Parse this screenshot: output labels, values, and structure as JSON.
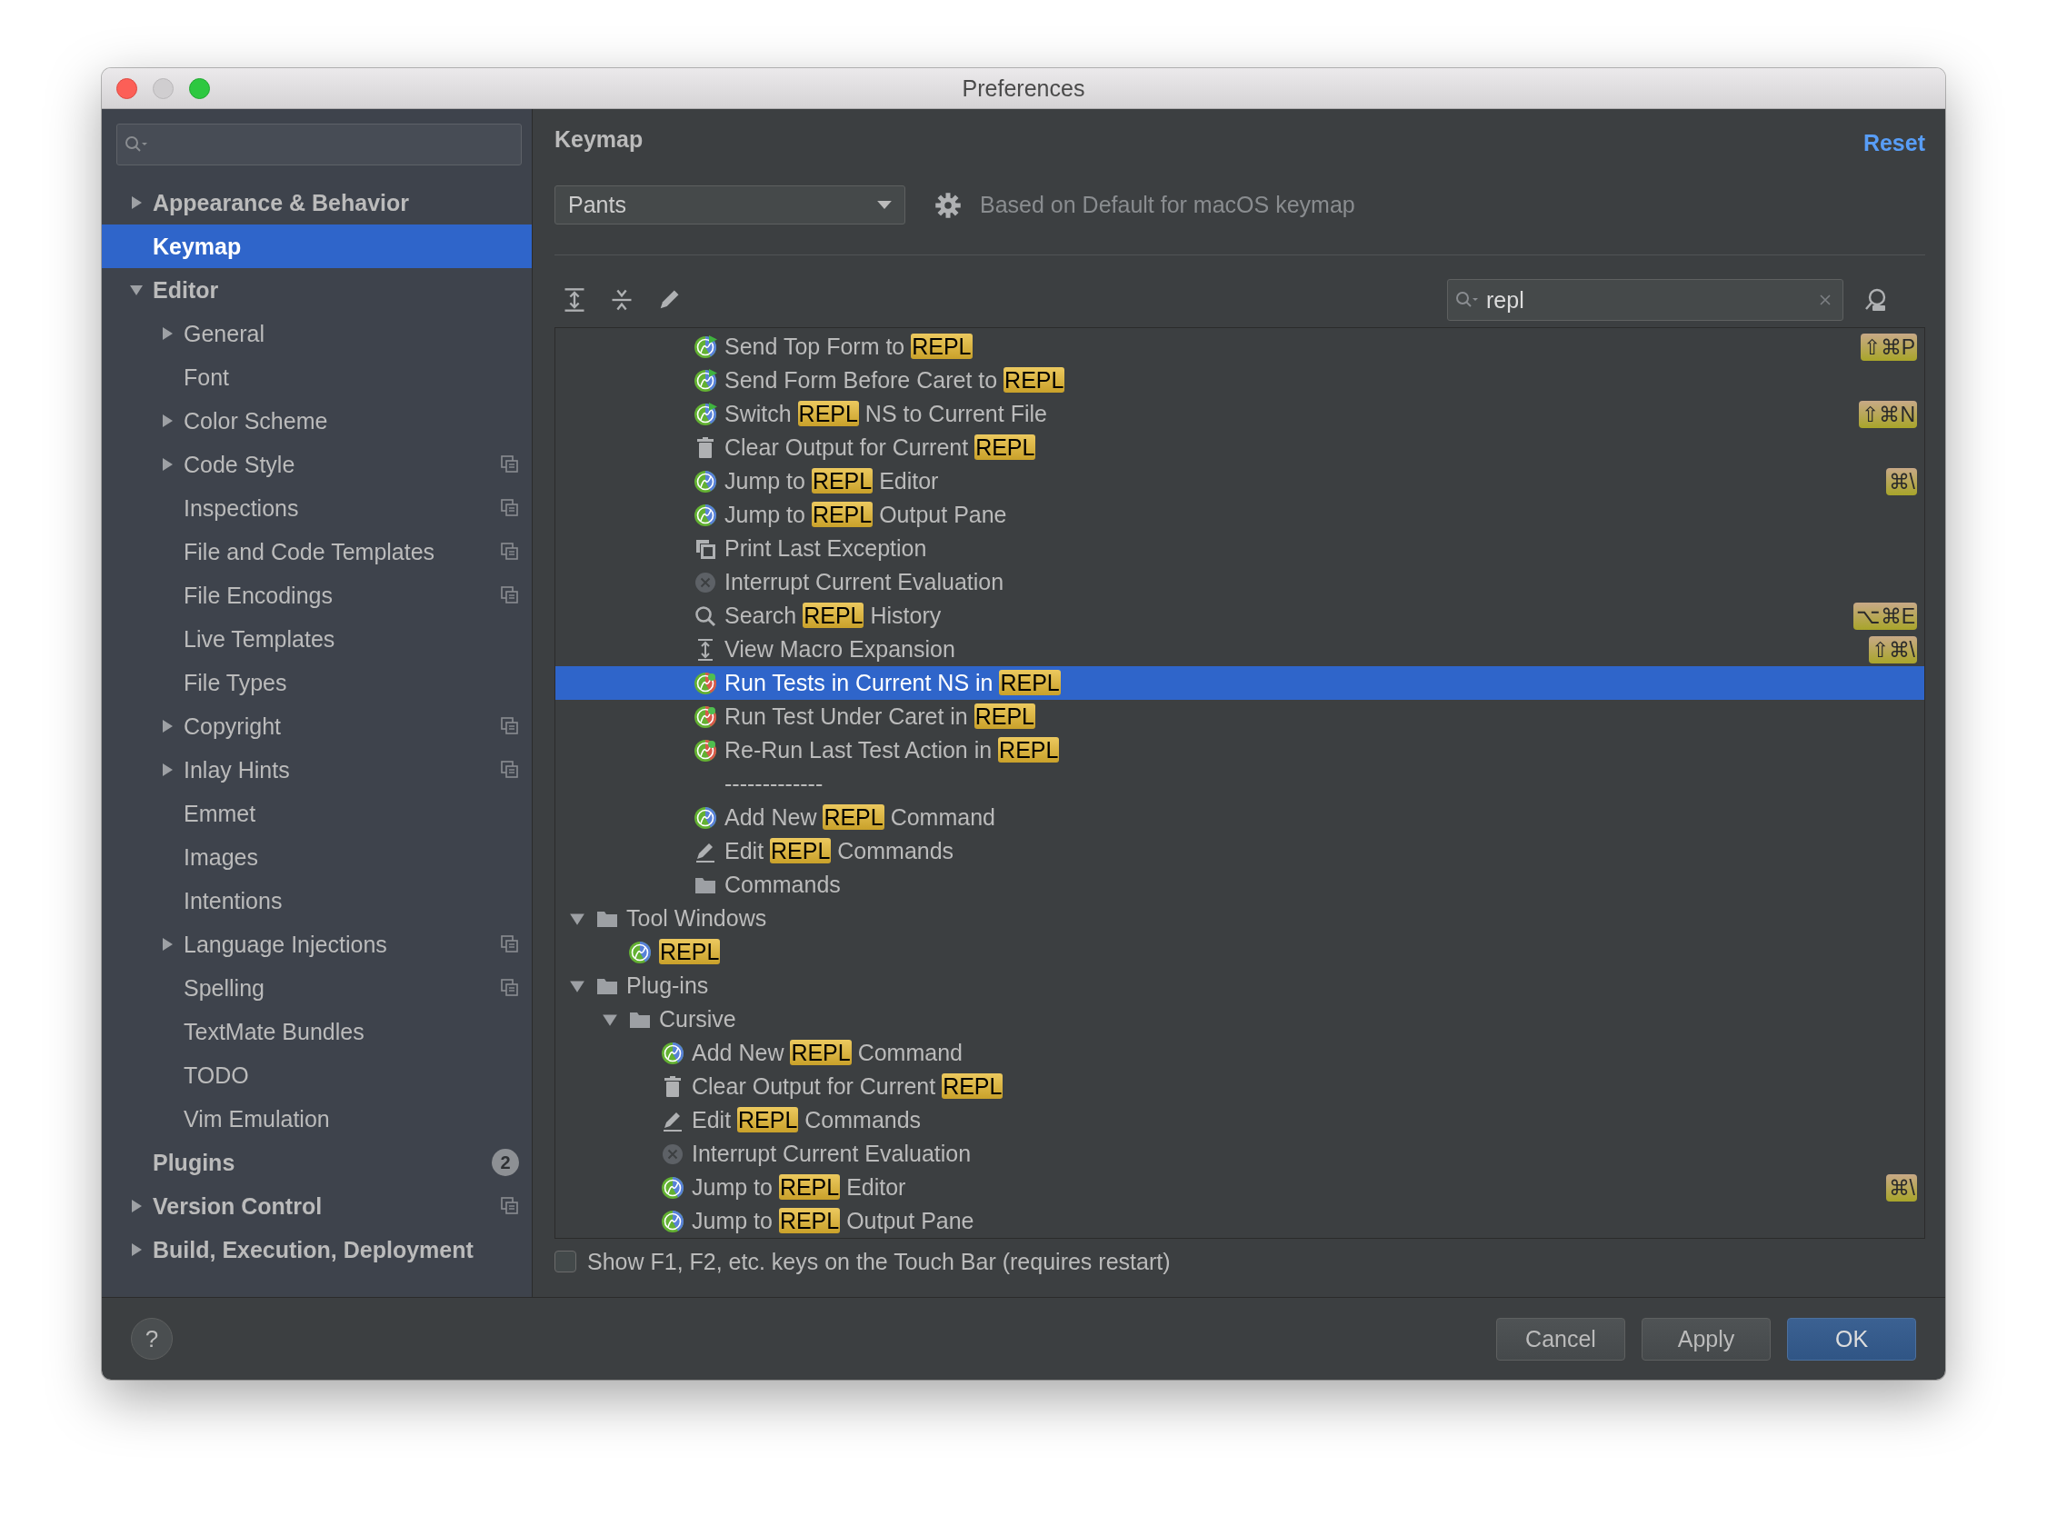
{
  "window": {
    "title": "Preferences"
  },
  "sidebar": {
    "items": [
      {
        "label": "Appearance & Behavior",
        "selected": false,
        "expanded": false,
        "project_scope": false
      },
      {
        "label": "Keymap",
        "selected": true,
        "project_scope": false
      },
      {
        "label": "Editor",
        "selected": false,
        "expanded": true,
        "project_scope": false,
        "children": [
          {
            "label": "General",
            "selected": false,
            "expanded": false,
            "project_scope": false
          },
          {
            "label": "Font",
            "selected": false,
            "project_scope": false
          },
          {
            "label": "Color Scheme",
            "selected": false,
            "expanded": false,
            "project_scope": false
          },
          {
            "label": "Code Style",
            "selected": false,
            "expanded": false,
            "project_scope": true
          },
          {
            "label": "Inspections",
            "selected": false,
            "project_scope": true
          },
          {
            "label": "File and Code Templates",
            "selected": false,
            "project_scope": true
          },
          {
            "label": "File Encodings",
            "selected": false,
            "project_scope": true
          },
          {
            "label": "Live Templates",
            "selected": false,
            "project_scope": false
          },
          {
            "label": "File Types",
            "selected": false,
            "project_scope": false
          },
          {
            "label": "Copyright",
            "selected": false,
            "expanded": false,
            "project_scope": true
          },
          {
            "label": "Inlay Hints",
            "selected": false,
            "expanded": false,
            "project_scope": true
          },
          {
            "label": "Emmet",
            "selected": false,
            "project_scope": false
          },
          {
            "label": "Images",
            "selected": false,
            "project_scope": false
          },
          {
            "label": "Intentions",
            "selected": false,
            "project_scope": false
          },
          {
            "label": "Language Injections",
            "selected": false,
            "expanded": false,
            "project_scope": true
          },
          {
            "label": "Spelling",
            "selected": false,
            "project_scope": true
          },
          {
            "label": "TextMate Bundles",
            "selected": false,
            "project_scope": false
          },
          {
            "label": "TODO",
            "selected": false,
            "project_scope": false
          },
          {
            "label": "Vim Emulation",
            "selected": false,
            "project_scope": false
          }
        ]
      },
      {
        "label": "Plugins",
        "selected": false,
        "project_scope": false,
        "badge": "2"
      },
      {
        "label": "Version Control",
        "selected": false,
        "expanded": false,
        "project_scope": true
      },
      {
        "label": "Build, Execution, Deployment",
        "selected": false,
        "expanded": false,
        "project_scope": false
      }
    ]
  },
  "keymap": {
    "title": "Keymap",
    "reset": "Reset",
    "scheme": "Pants",
    "based_on": "Based on Default for macOS keymap",
    "search": {
      "value": "repl"
    }
  },
  "keymap_tree": {
    "continued_rows": [
      {
        "kind": "cursive-send",
        "label": [
          {
            "text": "Send Top Form to ",
            "match": false
          },
          {
            "text": "REPL",
            "match": true
          }
        ],
        "shortcut": "⇧⌘P",
        "selected": false
      },
      {
        "kind": "cursive-send",
        "label": [
          {
            "text": "Send Form Before Caret to ",
            "match": false
          },
          {
            "text": "REPL",
            "match": true
          }
        ],
        "selected": false
      },
      {
        "kind": "cursive-send",
        "label": [
          {
            "text": "Switch ",
            "match": false
          },
          {
            "text": "REPL",
            "match": true
          },
          {
            "text": " NS to Current File",
            "match": false
          }
        ],
        "shortcut": "⇧⌘N",
        "selected": false
      },
      {
        "kind": "trash",
        "label": [
          {
            "text": "Clear Output for Current ",
            "match": false
          },
          {
            "text": "REPL",
            "match": true
          }
        ],
        "selected": false
      },
      {
        "kind": "cursive",
        "label": [
          {
            "text": "Jump to ",
            "match": false
          },
          {
            "text": "REPL",
            "match": true
          },
          {
            "text": " Editor",
            "match": false
          }
        ],
        "shortcut": "⌘\\",
        "selected": false
      },
      {
        "kind": "cursive",
        "label": [
          {
            "text": "Jump to ",
            "match": false
          },
          {
            "text": "REPL",
            "match": true
          },
          {
            "text": " Output Pane",
            "match": false
          }
        ],
        "selected": false
      },
      {
        "kind": "copy",
        "label": [
          {
            "text": "Print Last Exception",
            "match": false
          }
        ],
        "selected": false
      },
      {
        "kind": "stop",
        "label": [
          {
            "text": "Interrupt Current Evaluation",
            "match": false
          }
        ],
        "selected": false
      },
      {
        "kind": "search",
        "label": [
          {
            "text": "Search ",
            "match": false
          },
          {
            "text": "REPL",
            "match": true
          },
          {
            "text": " History",
            "match": false
          }
        ],
        "shortcut": "⌥⌘E",
        "selected": false
      },
      {
        "kind": "macro",
        "label": [
          {
            "text": "View Macro Expansion",
            "match": false
          }
        ],
        "shortcut": "⇧⌘\\",
        "selected": false
      },
      {
        "kind": "cursive-test",
        "label": [
          {
            "text": "Run Tests in Current NS in ",
            "match": false
          },
          {
            "text": "REPL",
            "match": true
          }
        ],
        "selected": true
      },
      {
        "kind": "cursive-test",
        "label": [
          {
            "text": "Run Test Under Caret in ",
            "match": false
          },
          {
            "text": "REPL",
            "match": true
          }
        ],
        "selected": false
      },
      {
        "kind": "cursive-test",
        "label": [
          {
            "text": "Re-Run Last Test Action in ",
            "match": false
          },
          {
            "text": "REPL",
            "match": true
          }
        ],
        "selected": false
      },
      {
        "kind": "separator",
        "label": [
          {
            "text": "-------------",
            "match": false
          }
        ],
        "selected": false
      },
      {
        "kind": "cursive",
        "label": [
          {
            "text": "Add New ",
            "match": false
          },
          {
            "text": "REPL",
            "match": true
          },
          {
            "text": " Command",
            "match": false
          }
        ],
        "selected": false
      },
      {
        "kind": "pencil",
        "label": [
          {
            "text": "Edit ",
            "match": false
          },
          {
            "text": "REPL",
            "match": true
          },
          {
            "text": " Commands",
            "match": false
          }
        ],
        "selected": false
      },
      {
        "kind": "folder",
        "label": [
          {
            "text": "Commands",
            "match": false
          }
        ],
        "selected": false
      }
    ],
    "items": [
      {
        "kind": "folder",
        "label": [
          {
            "text": "Tool Windows",
            "match": false
          }
        ],
        "expanded": true,
        "selected": false,
        "children": [
          {
            "kind": "cursive",
            "label": [
              {
                "text": "REPL",
                "match": true
              }
            ],
            "selected": false
          }
        ]
      },
      {
        "kind": "folder",
        "label": [
          {
            "text": "Plug-ins",
            "match": false
          }
        ],
        "expanded": true,
        "selected": false,
        "children": [
          {
            "kind": "folder",
            "label": [
              {
                "text": "Cursive",
                "match": false
              }
            ],
            "expanded": true,
            "selected": false,
            "children": [
              {
                "kind": "cursive",
                "label": [
                  {
                    "text": "Add New ",
                    "match": false
                  },
                  {
                    "text": "REPL",
                    "match": true
                  },
                  {
                    "text": " Command",
                    "match": false
                  }
                ],
                "selected": false
              },
              {
                "kind": "trash",
                "label": [
                  {
                    "text": "Clear Output for Current ",
                    "match": false
                  },
                  {
                    "text": "REPL",
                    "match": true
                  }
                ],
                "selected": false
              },
              {
                "kind": "pencil",
                "label": [
                  {
                    "text": "Edit ",
                    "match": false
                  },
                  {
                    "text": "REPL",
                    "match": true
                  },
                  {
                    "text": " Commands",
                    "match": false
                  }
                ],
                "selected": false
              },
              {
                "kind": "stop",
                "label": [
                  {
                    "text": "Interrupt Current Evaluation",
                    "match": false
                  }
                ],
                "selected": false
              },
              {
                "kind": "cursive",
                "label": [
                  {
                    "text": "Jump to ",
                    "match": false
                  },
                  {
                    "text": "REPL",
                    "match": true
                  },
                  {
                    "text": " Editor",
                    "match": false
                  }
                ],
                "shortcut": "⌘\\",
                "selected": false
              },
              {
                "kind": "cursive",
                "label": [
                  {
                    "text": "Jump to ",
                    "match": false
                  },
                  {
                    "text": "REPL",
                    "match": true
                  },
                  {
                    "text": " Output Pane",
                    "match": false
                  }
                ],
                "selected": false
              }
            ]
          }
        ]
      }
    ]
  },
  "touch_bar_option": {
    "label": "Show F1, F2, etc. keys on the Touch Bar (requires restart)",
    "checked": false
  },
  "help": "?",
  "buttons": [
    {
      "label": "Cancel",
      "kind": "normal"
    },
    {
      "label": "Apply",
      "kind": "normal"
    },
    {
      "label": "OK",
      "kind": "default"
    }
  ]
}
